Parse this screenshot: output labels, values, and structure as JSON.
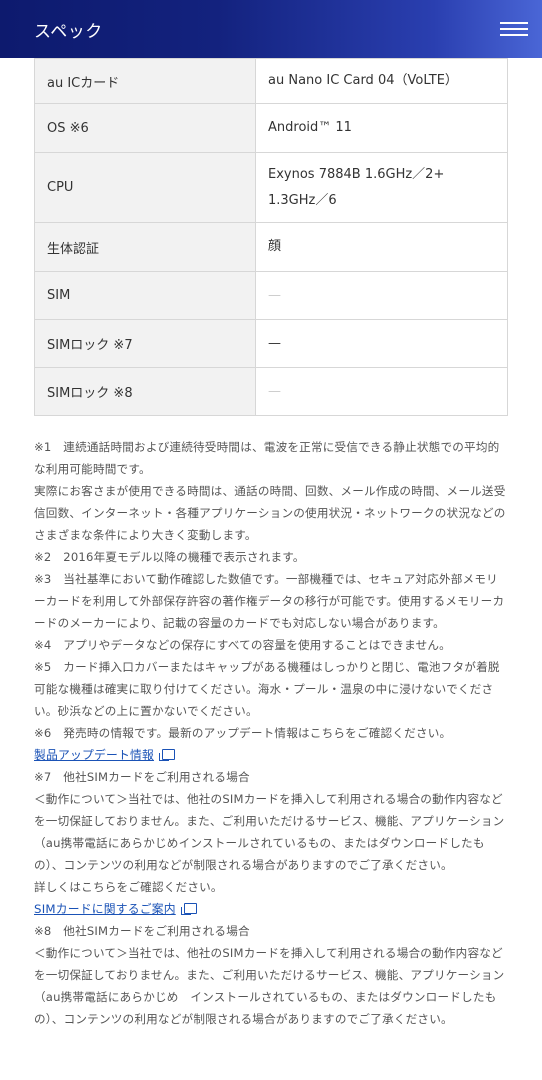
{
  "header": {
    "title": "スペック",
    "menu_icon": "hamburger-menu-icon"
  },
  "colors": {
    "header_start": "#0d1a6e",
    "header_end": "#4a66d6",
    "link": "#1a52b6"
  },
  "spec_rows": [
    {
      "label": "au ICカード",
      "value": "au Nano IC Card 04（VoLTE）"
    },
    {
      "label": "OS ※6",
      "value": "Android™ 11"
    },
    {
      "label": "CPU",
      "value": "Exynos 7884B 1.6GHz／2+ 1.3GHz／6"
    },
    {
      "label": "生体認証",
      "value": "顔"
    },
    {
      "label": "SIM",
      "value": "—"
    },
    {
      "label": "SIMロック ※7",
      "value": "—"
    },
    {
      "label": "SIMロック ※8",
      "value": "—"
    }
  ],
  "notes": {
    "n1": "※1　連続通話時間および連続待受時間は、電波を正常に受信できる静止状態での平均的な利用可能時間です。",
    "n1b": "実際にお客さまが使用できる時間は、通話の時間、回数、メール作成の時間、メール送受信回数、インターネット・各種アプリケーションの使用状況・ネットワークの状況などのさまざまな条件により大きく変動します。",
    "n2": "※2　2016年夏モデル以降の機種で表示されます。",
    "n3": "※3　当社基準において動作確認した数値です。一部機種では、セキュア対応外部メモリーカードを利用して外部保存許容の著作権データの移行が可能です。使用するメモリーカードのメーカーにより、記載の容量のカードでも対応しない場合があります。",
    "n4": "※4　アプリやデータなどの保存にすべての容量を使用することはできません。",
    "n5": "※5　カード挿入口カバーまたはキャップがある機種はしっかりと閉じ、電池フタが着脱可能な機種は確実に取り付けてください。海水・プール・温泉の中に浸けないでください。砂浜などの上に置かないでください。",
    "n6": "※6　発売時の情報です。最新のアップデート情報はこちらをご確認ください。",
    "link1": "製品アップデート情報",
    "n7": "※7　他社SIMカードをご利用される場合",
    "n7b": "＜動作について＞当社では、他社のSIMカードを挿入して利用される場合の動作内容などを一切保証しておりません。また、ご利用いただけるサービス、機能、アプリケーション（au携帯電話にあらかじめインストールされているもの、またはダウンロードしたもの）、コンテンツの利用などが制限される場合がありますのでご了承ください。",
    "n7c": "詳しくはこちらをご確認ください。",
    "link2": "SIMカードに関するご案内",
    "n8": "※8　他社SIMカードをご利用される場合",
    "n8b": "＜動作について＞当社では、他社のSIMカードを挿入して利用される場合の動作内容などを一切保証しておりません。また、ご利用いただけるサービス、機能、アプリケーション（au携帯電話にあらかじめ　インストールされているもの、またはダウンロードしたもの）、コンテンツの利用などが制限される場合がありますのでご了承ください。"
  }
}
